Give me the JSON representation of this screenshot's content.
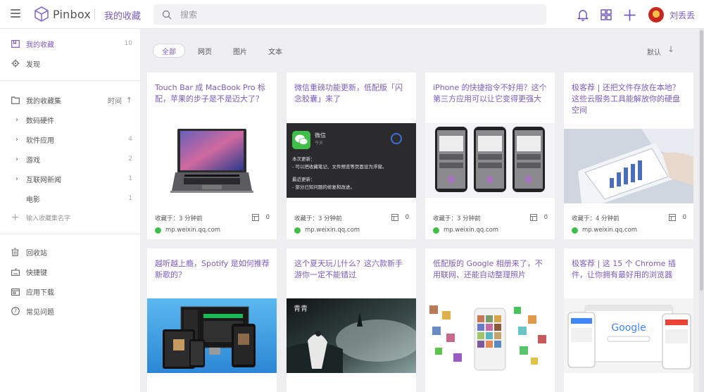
{
  "app": {
    "name": "Pinbox",
    "breadcrumb": "我的收藏"
  },
  "search": {
    "placeholder": "搜索"
  },
  "user": {
    "name": "刘丢丢"
  },
  "sidebar": {
    "primary": [
      {
        "label": "我的收藏",
        "count": "10",
        "icon": "bookmark-icon"
      },
      {
        "label": "发现",
        "icon": "compass-icon"
      }
    ],
    "collections_header": {
      "label": "我的收藏集",
      "sort": "时间"
    },
    "collections": [
      {
        "label": "数码硬件",
        "count": ""
      },
      {
        "label": "软件应用",
        "count": "4"
      },
      {
        "label": "游戏",
        "count": "2"
      },
      {
        "label": "互联网新闻",
        "count": "1"
      },
      {
        "label": "电影",
        "count": "1"
      }
    ],
    "add_collection": "输入收藏集名字",
    "footer": [
      {
        "label": "回收站",
        "icon": "trash-icon"
      },
      {
        "label": "快捷键",
        "icon": "keyboard-icon"
      },
      {
        "label": "应用下载",
        "icon": "download-icon"
      },
      {
        "label": "常见问题",
        "icon": "help-icon"
      }
    ]
  },
  "filters": {
    "tabs": [
      "全部",
      "网页",
      "图片",
      "文本"
    ],
    "sort": "默认"
  },
  "cards": [
    {
      "title": "Touch Bar 成 MacBook Pro 标配，苹果的步子是不是迈大了？",
      "time": "收藏于：3 分钟前",
      "notes": "0",
      "source": "mp.weixin.qq.com"
    },
    {
      "title": "微信重磅功能更新，低配版「闪念胶囊」来了",
      "time": "收藏于：3 分钟前",
      "notes": "0",
      "source": "mp.weixin.qq.com",
      "wechat": {
        "app": "微信",
        "sub": "今天",
        "l1": "本次更新：",
        "l2": "- 可以把收藏笔记、文件预览等页面设为浮窗。",
        "l3": "最近更新：",
        "l4": "- 部分已知问题的修复和改进。"
      }
    },
    {
      "title": "iPhone 的快捷指令不好用？这个第三方应用可以让它变得更强大",
      "time": "收藏于：3 分钟前",
      "notes": "0",
      "source": "mp.weixin.qq.com"
    },
    {
      "title": "极客荐 | 还把文件存放在本地？这些云服务工具能解放你的硬盘空间",
      "time": "收藏于：4 分钟前",
      "notes": "0",
      "source": "mp.weixin.qq.com"
    },
    {
      "title": "越听越上瘾，Spotify 是如何推荐新歌的？",
      "time": "",
      "notes": "",
      "source": ""
    },
    {
      "title": "这个夏天玩儿什么？这六款新手游你一定不能错过",
      "time": "",
      "notes": "",
      "source": ""
    },
    {
      "title": "低配版的 Google 相册来了，不用联网、还能自动整理照片",
      "time": "",
      "notes": "",
      "source": ""
    },
    {
      "title": "极客荐 | 这 15 个 Chrome 插件，让你拥有最好用的浏览器",
      "time": "",
      "notes": "",
      "source": "",
      "google": "Google"
    }
  ],
  "colors": {
    "accent": "#7b5cc0",
    "background": "#efeff1",
    "wechat_green": "#3fbf4a"
  }
}
